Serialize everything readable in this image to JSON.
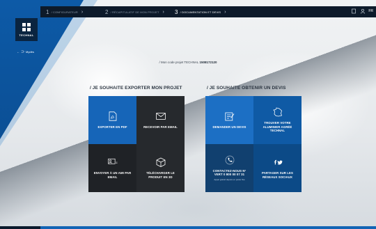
{
  "steps": [
    {
      "num": "1",
      "label": "/ configurateur",
      "active": false
    },
    {
      "num": "2",
      "label": "/ récapitulatif de mon projet",
      "active": false
    },
    {
      "num": "3",
      "label": "/ documentation et devis",
      "active": true
    }
  ],
  "topbar_icons": [
    "document-icon",
    "user-icon"
  ],
  "lang": "FR",
  "logo_text": "TECHNAL",
  "back_label": "Mydès",
  "project_code_prefix": "/ Mon code projet TECHNAL",
  "project_code_value": "1508172120",
  "export_section": {
    "title": "/ Je souhaite exporter mon projet",
    "tiles": [
      {
        "label": "Exporter en PDF",
        "icon": "pdf-icon"
      },
      {
        "label": "Recevoir par email",
        "icon": "envelope-icon"
      },
      {
        "label": "Envoyer à un ami par email",
        "icon": "share-email-icon"
      },
      {
        "label": "Télécharger le produit en 3D",
        "icon": "cube-3d-icon"
      }
    ]
  },
  "quote_section": {
    "title": "/ Je souhaite obtenir un devis",
    "tiles": [
      {
        "label": "Demander un devis",
        "icon": "quote-request-icon"
      },
      {
        "label": "Trouver votre aluminier agréé TECHNAL",
        "icon": "france-map-icon"
      },
      {
        "label": "Contactez-nous N° Vert 0 800 00 07 31",
        "sub": "Appel gratuit depuis un poste fixe",
        "icon": "phone-icon"
      },
      {
        "label": "Partager sur les réseaux sociaux",
        "icon": "social-icon"
      }
    ]
  },
  "colors": {
    "accent": "#1665b8",
    "dark_tile": "#26292d",
    "topbar": "#0d1a2a"
  }
}
